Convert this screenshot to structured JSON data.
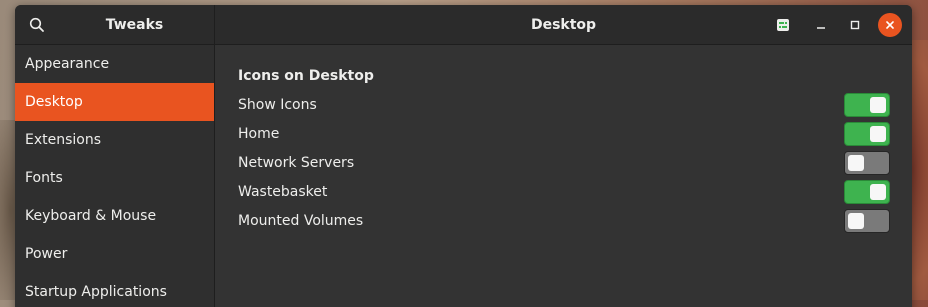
{
  "window": {
    "app_title": "Tweaks",
    "page_title": "Desktop"
  },
  "sidebar": {
    "items": [
      {
        "label": "Appearance",
        "active": false
      },
      {
        "label": "Desktop",
        "active": true
      },
      {
        "label": "Extensions",
        "active": false
      },
      {
        "label": "Fonts",
        "active": false
      },
      {
        "label": "Keyboard & Mouse",
        "active": false
      },
      {
        "label": "Power",
        "active": false
      },
      {
        "label": "Startup Applications",
        "active": false
      }
    ]
  },
  "content": {
    "section_title": "Icons on Desktop",
    "settings": [
      {
        "label": "Show Icons",
        "enabled": true
      },
      {
        "label": "Home",
        "enabled": true
      },
      {
        "label": "Network Servers",
        "enabled": false
      },
      {
        "label": "Wastebasket",
        "enabled": true
      },
      {
        "label": "Mounted Volumes",
        "enabled": false
      }
    ]
  },
  "colors": {
    "accent": "#e95420",
    "switch_on": "#3eb34f",
    "switch_off": "#7a7a7a"
  },
  "icons": {
    "search": "search-icon",
    "app_menu": "app-menu-icon",
    "minimize": "minimize-icon",
    "maximize": "maximize-icon",
    "close": "close-icon"
  }
}
